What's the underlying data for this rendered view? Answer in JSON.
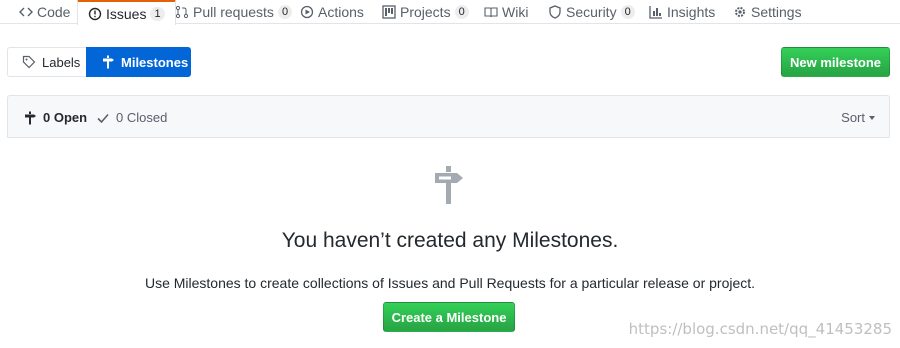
{
  "nav": {
    "tabs": [
      {
        "label": "Code",
        "icon": "code-icon"
      },
      {
        "label": "Issues",
        "count": "1",
        "icon": "issue-icon",
        "selected": true
      },
      {
        "label": "Pull requests",
        "count": "0",
        "icon": "pull-request-icon"
      },
      {
        "label": "Actions",
        "icon": "play-icon"
      },
      {
        "label": "Projects",
        "count": "0",
        "icon": "project-icon"
      },
      {
        "label": "Wiki",
        "icon": "book-icon"
      },
      {
        "label": "Security",
        "count": "0",
        "icon": "shield-icon"
      },
      {
        "label": "Insights",
        "icon": "graph-icon"
      },
      {
        "label": "Settings",
        "icon": "gear-icon"
      }
    ]
  },
  "subnav": {
    "labels": "Labels",
    "milestones": "Milestones"
  },
  "new_milestone_label": "New milestone",
  "filter": {
    "open": "0 Open",
    "closed": "0 Closed",
    "sort": "Sort"
  },
  "blankslate": {
    "title": "You haven’t created any Milestones.",
    "description": "Use Milestones to create collections of Issues and Pull Requests for a particular release or project.",
    "button": "Create a Milestone"
  },
  "watermark": "https://blog.csdn.net/qq_41453285",
  "colors": {
    "primary_green": "#28a745",
    "selected_blue": "#0366d6",
    "tab_accent": "#e36209"
  }
}
